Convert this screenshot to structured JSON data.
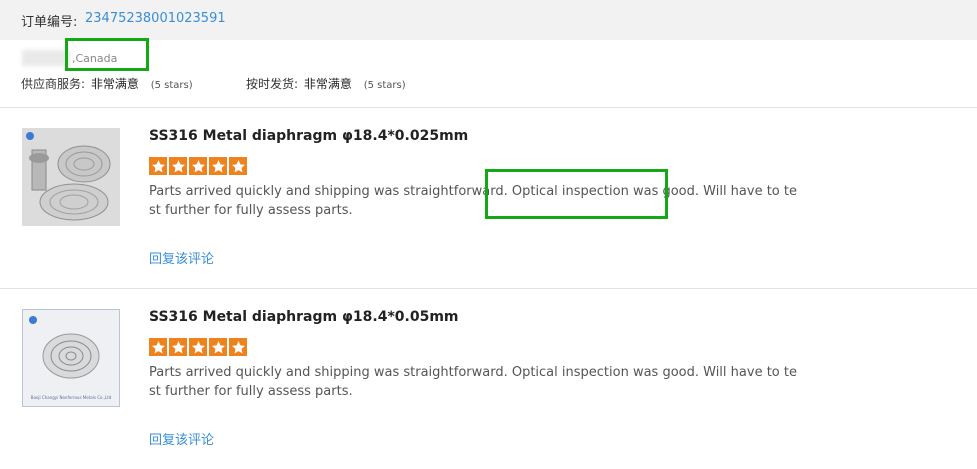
{
  "order": {
    "label": "订单编号:",
    "number": "23475238001023591"
  },
  "buyer": {
    "country": ",Canada"
  },
  "ratings": [
    {
      "label": "供应商服务:",
      "value": "非常满意",
      "stars": "(5 stars)"
    },
    {
      "label": "按时发货:",
      "value": "非常满意",
      "stars": "(5 stars)"
    }
  ],
  "reviews": [
    {
      "title": "SS316 Metal diaphragm φ18.4*0.025mm",
      "rating": 5,
      "text_a": "Parts arrived quickly and shipping was straightforward. ",
      "text_b": "Optical inspection was good.",
      "text_c": " Will have to test further for fully assess parts.",
      "reply": "回复该评论"
    },
    {
      "title": "SS316 Metal diaphragm φ18.4*0.05mm",
      "rating": 5,
      "text": "Parts arrived quickly and shipping was straightforward.  Optical inspection was good.  Will have to test further for fully assess parts.",
      "reply": "回复该评论",
      "image_caption": "Baoji Changyi Nonferrous Metals Co.,Ltd"
    }
  ],
  "colors": {
    "link": "#3a8ed4",
    "star": "#f0821e",
    "highlight": "#14a814"
  }
}
